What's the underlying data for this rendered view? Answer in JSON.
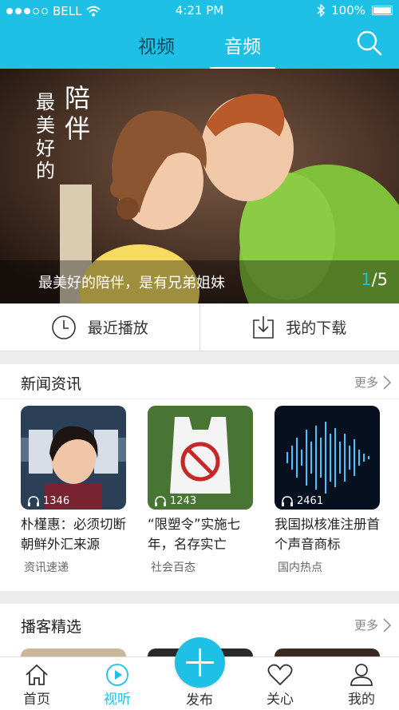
{
  "status": {
    "carrier": "BELL",
    "time": "4:21 PM",
    "battery": "100%"
  },
  "nav": {
    "tabs": [
      "视频",
      "音频"
    ],
    "active_tab": "音频"
  },
  "banner": {
    "title_small": [
      "最",
      "美",
      "好",
      "的"
    ],
    "title_big": [
      "陪",
      "伴"
    ],
    "caption": "最美好的陪伴，是有兄弟姐妹",
    "page_current": "1",
    "page_total": "/5"
  },
  "actions": [
    {
      "label": "最近播放",
      "icon": "clock-icon"
    },
    {
      "label": "我的下载",
      "icon": "download-icon"
    }
  ],
  "news": {
    "title": "新闻资讯",
    "more": "更多",
    "items": [
      {
        "plays": "1346",
        "title": "朴槿惠：必须切断朝鲜外汇来源",
        "category": "资讯速递"
      },
      {
        "plays": "1243",
        "title": "“限塑令”实施七年，名存实亡",
        "category": "社会百态"
      },
      {
        "plays": "2461",
        "title": "我国拟核准注册首个声音商标",
        "category": "国内热点"
      }
    ]
  },
  "podcast": {
    "title": "播客精选",
    "more": "更多"
  },
  "tabbar": {
    "items": [
      {
        "label": "首页",
        "icon": "home-icon"
      },
      {
        "label": "视听",
        "icon": "play-circle-icon"
      },
      {
        "label": "发布",
        "icon": "plus-icon"
      },
      {
        "label": "关心",
        "icon": "heart-icon"
      },
      {
        "label": "我的",
        "icon": "user-icon"
      }
    ],
    "active": "视听"
  },
  "colors": {
    "accent": "#1ec0e6",
    "header_bg": "#1ec0e6",
    "inactive_tab": "#0d4f5c"
  }
}
